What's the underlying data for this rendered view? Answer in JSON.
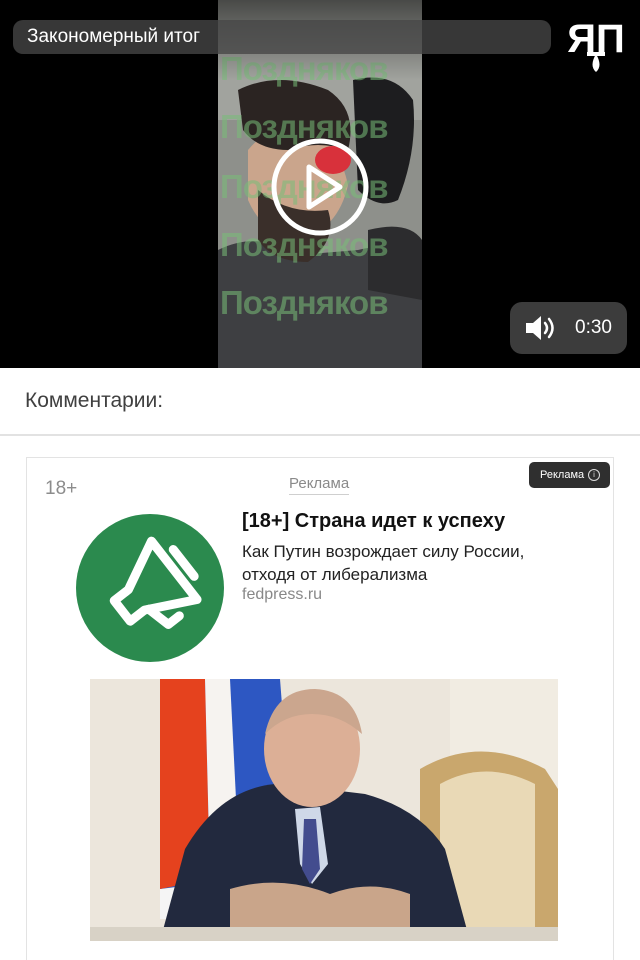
{
  "video": {
    "title": "Закономерный итог",
    "watermark": "Поздняков",
    "duration": "0:30",
    "logo_text": "ЯП",
    "play_icon": "play-icon",
    "sound_icon": "speaker-icon"
  },
  "comments": {
    "title": "Комментарии:"
  },
  "ad": {
    "age_label": "18+",
    "caption": "Реклама",
    "badge_label": "Реклама",
    "headline": "[18+] Страна идет к успеху",
    "text": "Как Путин возрождает силу России, отходя от либерализма",
    "domain": "fedpress.ru",
    "logo_icon": "megaphone-icon",
    "logo_color": "#2b8a4e"
  }
}
